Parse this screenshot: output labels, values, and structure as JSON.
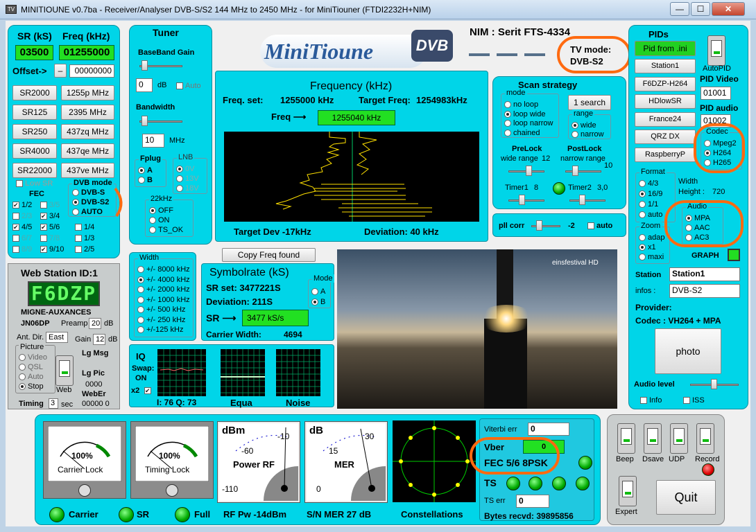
{
  "window": {
    "title": "MINITIOUNE v0.7ba - Receiver/Analyser DVB-S/S2 144 MHz to 2450 MHz - for MiniTiouner (FTDI2232H+NIM)",
    "app_icon": "tv-icon",
    "minimize": "—",
    "maximize": "☐",
    "close": "✕"
  },
  "logo": {
    "text": "MiniTioune",
    "badge": "DVB"
  },
  "nim": {
    "label": "NIM : Serit FTS-4334",
    "tv_mode_label": "TV mode:",
    "tv_mode_value": "DVB-S2"
  },
  "sr_panel": {
    "sr_label": "SR (kS)",
    "freq_label": "Freq (kHz)",
    "sr_value": "03500",
    "freq_value": "01255000",
    "offset_label": "Offset->",
    "offset_minus": "–",
    "offset_value": "00000000",
    "presets": [
      [
        "SR2000",
        "1255p MHz"
      ],
      [
        "SR125",
        "2395 MHz"
      ],
      [
        "SR250",
        "437zq MHz"
      ],
      [
        "SR4000",
        "437qe MHz"
      ],
      [
        "SR22000",
        "437ve MHz"
      ]
    ],
    "low_sr": "Low SR",
    "fec_label": "FEC",
    "fec": [
      [
        "1/2",
        "3/5"
      ],
      [
        "2/3",
        "3/4"
      ],
      [
        "4/5",
        "5/6",
        "1/4"
      ],
      [
        "6/7",
        "7/8",
        "1/3"
      ],
      [
        "8/9",
        "9/10",
        "2/5"
      ]
    ],
    "dvb_mode_label": "DVB mode",
    "dvb_modes": [
      "DVB-S",
      "DVB-S2",
      "AUTO"
    ]
  },
  "tuner": {
    "title": "Tuner",
    "bb_gain": "BaseBand Gain",
    "bb_value": "0",
    "db": "dB",
    "auto": "Auto",
    "bandwidth": "Bandwidth",
    "bw_value": "10",
    "mhz": "MHz",
    "fplug": "Fplug",
    "fplug_a": "A",
    "fplug_b": "B",
    "lnb": "LNB",
    "lnb_opts": [
      "0V",
      "13V",
      "18V"
    ],
    "k22": "22kHz",
    "k22_opts": [
      "OFF",
      "ON",
      "TS_OK"
    ]
  },
  "frequency": {
    "title": "Frequency (kHz)",
    "freq_set_label": "Freq. set:",
    "freq_set": "1255000 kHz",
    "target_label": "Target Freq:",
    "target": "1254983kHz",
    "freq_arrow": "Freq ⟶",
    "freq_value": "1255040 kHz",
    "target_dev": "Target Dev  -17kHz",
    "deviation": "Deviation: 40 kHz"
  },
  "scan": {
    "title": "Scan strategy",
    "mode": "mode",
    "modes": [
      "no loop",
      "loop wide",
      "loop narrow",
      "chained"
    ],
    "one_search": "1 search",
    "range": "range",
    "ranges": [
      "wide",
      "narrow"
    ],
    "prelock": "PreLock",
    "prelock_sub": "wide range",
    "prelock_val": "12",
    "postlock": "PostLock",
    "postlock_sub": "narrow range",
    "postlock_val": "10",
    "timer1": "Timer1",
    "timer1_val": "8",
    "timer2": "Timer2",
    "timer2_val": "3,0"
  },
  "pll": {
    "label": "pll corr",
    "value": "-2",
    "auto": "auto"
  },
  "copy_freq": "Copy Freq found",
  "width_panel": {
    "title": "Width",
    "opts": [
      "+/- 8000 kHz",
      "+/- 4000 kHz",
      "+/- 2000 kHz",
      "+/- 1000 kHz",
      "+/- 500 kHz",
      "+/- 250 kHz",
      "+/-125 kHz"
    ]
  },
  "symbolrate": {
    "title": "Symbolrate (kS)",
    "sr_set": "SR set:  3477221S",
    "deviation": "Deviation: 211S",
    "sr_arrow": "SR ⟶",
    "sr_value": "3477 kS/s",
    "carrier_width": "Carrier Width:",
    "cw_value": "4694",
    "mode": "Mode",
    "mode_a": "A",
    "mode_b": "B"
  },
  "video": {
    "channel_logo": "einsfestival HD"
  },
  "iq": {
    "title": "IQ",
    "swap": "Swap:",
    "on": "ON",
    "x2": "x2",
    "iq_values": "I: 76 Q: 73",
    "equa": "Equa",
    "noise": "Noise"
  },
  "web": {
    "title": "Web Station ID:1",
    "callsign": "F6DZP",
    "location": "MIGNE-AUXANCES",
    "locator": "JN06DP",
    "preamp": "Preamp",
    "preamp_val": "20",
    "db": "dB",
    "ant_dir": "Ant. Dir.",
    "ant_val": "East",
    "gain": "Gain",
    "gain_val": "12",
    "picture": "Picture",
    "pic_opts": [
      "Video",
      "QSL",
      "Auto",
      "Stop"
    ],
    "web_btn": "Web",
    "lg_msg": "Lg Msg",
    "lg_pic": "Lg Pic",
    "lg_pic_val": "0000",
    "weber": "WebEr",
    "weber_val": "00000  0",
    "timing": "Timing",
    "timing_val": "3",
    "sec": "sec"
  },
  "pids": {
    "title": "PIDs",
    "pid_ini": "Pid from .ini",
    "stations": [
      "Station1",
      "F6DZP-H264",
      "HDlowSR",
      "France24",
      "QRZ DX",
      "RaspberryP"
    ],
    "autopid": "AutoPID",
    "pid_video": "PID Video",
    "pid_video_val": "01001",
    "pid_audio": "PID audio",
    "pid_audio_val": "01002",
    "codec": "Codec",
    "codecs": [
      "Mpeg2",
      "H264",
      "H265"
    ],
    "format": "Format",
    "formats": [
      "4/3",
      "16/9",
      "1/1",
      "auto"
    ],
    "width": "Width",
    "height": "Height :",
    "height_val": "720",
    "audio": "Audio",
    "audios": [
      "MPA",
      "AAC",
      "AC3"
    ],
    "zoom": "Zoom",
    "zooms": [
      "adap",
      "x1",
      "maxi"
    ],
    "graph": "GRAPH",
    "station_label": "Station",
    "station_val": "Station1",
    "infos_label": "infos :",
    "infos_val": "DVB-S2",
    "provider": "Provider:",
    "codec_line": "Codec :    VH264 + MPA",
    "photo": "photo",
    "audio_level": "Audio level",
    "info": "Info",
    "iss": "ISS"
  },
  "bottom": {
    "carrier_lock_pct": "100%",
    "carrier_lock": "Carrier Lock",
    "timing_lock_pct": "100%",
    "timing_lock": "Timing Lock",
    "power_unit": "dBm",
    "power_title": "Power RF",
    "power_ticks": [
      "-10",
      "-60",
      "-110"
    ],
    "mer_unit": "dB",
    "mer_title": "MER",
    "mer_ticks": [
      "30",
      "15",
      "0"
    ],
    "leds": [
      "Carrier",
      "SR",
      "Full"
    ],
    "rf_pw": "RF Pw -14dBm",
    "sn_mer": "S/N MER  27 dB",
    "constellations": "Constellations",
    "viterbi": "Viterbi err",
    "viterbi_val": "0",
    "vber": "Vber",
    "vber_val": "0",
    "fec_mod": "FEC 5/6 8PSK",
    "ts": "TS",
    "ts_err": "TS err",
    "ts_err_val": "0",
    "bytes": "Bytes recvd:  39895856"
  },
  "controls": {
    "switches": [
      "Beep",
      "Dsave",
      "UDP",
      "Record"
    ],
    "expert": "Expert",
    "quit": "Quit"
  }
}
